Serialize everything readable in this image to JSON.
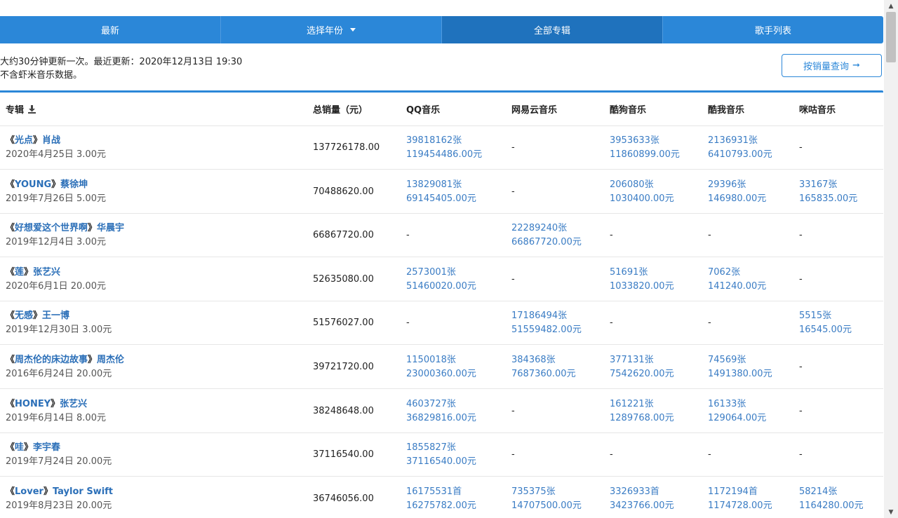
{
  "tabs": [
    {
      "label": "最新"
    },
    {
      "label": "选择年份"
    },
    {
      "label": "全部专辑"
    },
    {
      "label": "歌手列表"
    }
  ],
  "info": {
    "line1": "大约30分钟更新一次。最近更新：2020年12月13日 19:30",
    "line2": "不含虾米音乐数据。"
  },
  "sales_button": {
    "label": "按销量查询",
    "arrow": "➞"
  },
  "table": {
    "headers": {
      "album": "专辑",
      "total": "总销量（元）",
      "qq": "QQ音乐",
      "netease": "网易云音乐",
      "kugou": "酷狗音乐",
      "kuwo": "酷我音乐",
      "migu": "咪咕音乐"
    },
    "rows": [
      {
        "album_open": "《",
        "album": "光点",
        "album_close": "》",
        "artist": "肖战",
        "meta": "2020年4月25日  3.00元",
        "total": "137726178.00",
        "qq": [
          "39818162张",
          "119454486.00元"
        ],
        "netease": [
          "-"
        ],
        "kugou": [
          "3953633张",
          "11860899.00元"
        ],
        "kuwo": [
          "2136931张",
          "6410793.00元"
        ],
        "migu": [
          "-"
        ]
      },
      {
        "album_open": "《",
        "album": "YOUNG",
        "album_close": "》",
        "artist": "蔡徐坤",
        "meta": "2019年7月26日  5.00元",
        "total": "70488620.00",
        "qq": [
          "13829081张",
          "69145405.00元"
        ],
        "netease": [
          "-"
        ],
        "kugou": [
          "206080张",
          "1030400.00元"
        ],
        "kuwo": [
          "29396张",
          "146980.00元"
        ],
        "migu": [
          "33167张",
          "165835.00元"
        ]
      },
      {
        "album_open": "《",
        "album": "好想爱这个世界啊",
        "album_close": "》",
        "artist": "华晨宇",
        "meta": "2019年12月4日  3.00元",
        "total": "66867720.00",
        "qq": [
          "-"
        ],
        "netease": [
          "22289240张",
          "66867720.00元"
        ],
        "kugou": [
          "-"
        ],
        "kuwo": [
          "-"
        ],
        "migu": [
          "-"
        ]
      },
      {
        "album_open": "《",
        "album": "莲",
        "album_close": "》",
        "artist": "张艺兴",
        "meta": "2020年6月1日  20.00元",
        "total": "52635080.00",
        "qq": [
          "2573001张",
          "51460020.00元"
        ],
        "netease": [
          "-"
        ],
        "kugou": [
          "51691张",
          "1033820.00元"
        ],
        "kuwo": [
          "7062张",
          "141240.00元"
        ],
        "migu": [
          "-"
        ]
      },
      {
        "album_open": "《",
        "album": "无感",
        "album_close": "》",
        "artist": "王一博",
        "meta": "2019年12月30日  3.00元",
        "total": "51576027.00",
        "qq": [
          "-"
        ],
        "netease": [
          "17186494张",
          "51559482.00元"
        ],
        "kugou": [
          "-"
        ],
        "kuwo": [
          "-"
        ],
        "migu": [
          "5515张",
          "16545.00元"
        ]
      },
      {
        "album_open": "《",
        "album": "周杰伦的床边故事",
        "album_close": "》",
        "artist": "周杰伦",
        "meta": "2016年6月24日  20.00元",
        "total": "39721720.00",
        "qq": [
          "1150018张",
          "23000360.00元"
        ],
        "netease": [
          "384368张",
          "7687360.00元"
        ],
        "kugou": [
          "377131张",
          "7542620.00元"
        ],
        "kuwo": [
          "74569张",
          "1491380.00元"
        ],
        "migu": [
          "-"
        ]
      },
      {
        "album_open": "《",
        "album": "HONEY",
        "album_close": "》",
        "artist": "张艺兴",
        "meta": "2019年6月14日  8.00元",
        "total": "38248648.00",
        "qq": [
          "4603727张",
          "36829816.00元"
        ],
        "netease": [
          "-"
        ],
        "kugou": [
          "161221张",
          "1289768.00元"
        ],
        "kuwo": [
          "16133张",
          "129064.00元"
        ],
        "migu": [
          "-"
        ]
      },
      {
        "album_open": "《",
        "album": "哇",
        "album_close": "》",
        "artist": "李宇春",
        "meta": "2019年7月24日  20.00元",
        "total": "37116540.00",
        "qq": [
          "1855827张",
          "37116540.00元"
        ],
        "netease": [
          "-"
        ],
        "kugou": [
          "-"
        ],
        "kuwo": [
          "-"
        ],
        "migu": [
          "-"
        ]
      },
      {
        "album_open": "《",
        "album": "Lover",
        "album_close": "》",
        "artist": "Taylor Swift",
        "meta": "2019年8月23日  20.00元",
        "total": "36746056.00",
        "qq": [
          "16175531首",
          "16275782.00元"
        ],
        "netease": [
          "735375张",
          "14707500.00元"
        ],
        "kugou": [
          "3326933首",
          "3423766.00元"
        ],
        "kuwo": [
          "1172194首",
          "1174728.00元"
        ],
        "migu": [
          "58214张",
          "1164280.00元"
        ]
      }
    ]
  },
  "colors": {
    "accent": "#2b87d8",
    "active_tab": "#1f72bd",
    "link": "#3a7cc4"
  }
}
